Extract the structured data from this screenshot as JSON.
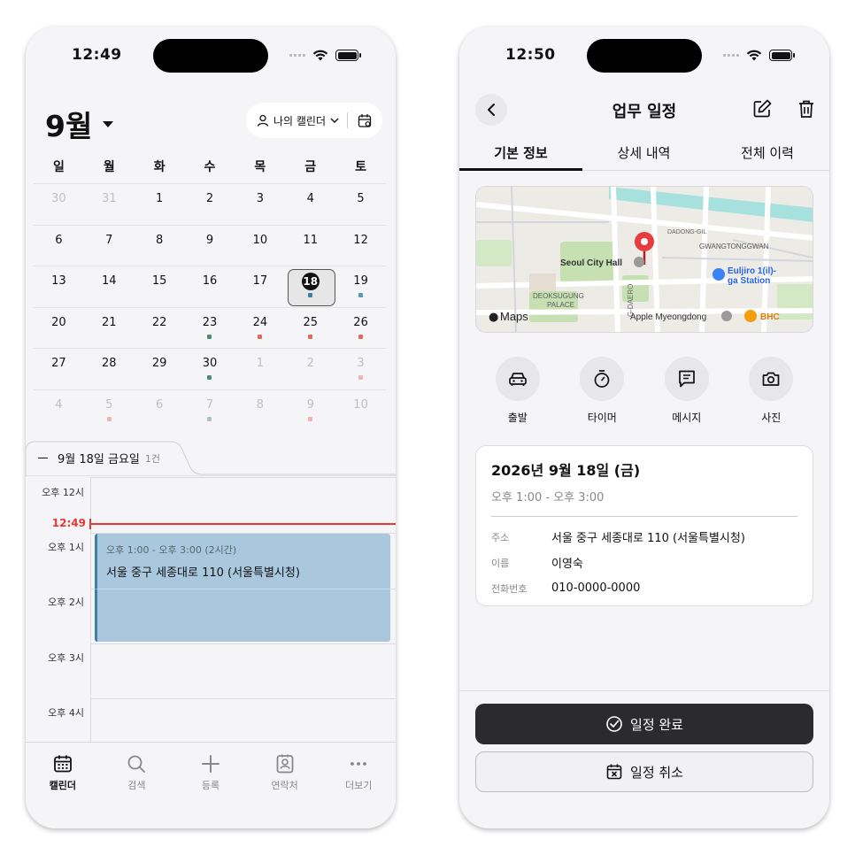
{
  "left": {
    "status": {
      "time": "12:49"
    },
    "header": {
      "month": "9월",
      "calendar_label": "나의 캘린더"
    },
    "weekdays": [
      "일",
      "월",
      "화",
      "수",
      "목",
      "금",
      "토"
    ],
    "weeks": [
      [
        {
          "d": "30",
          "m": true
        },
        {
          "d": "31",
          "m": true
        },
        {
          "d": "1"
        },
        {
          "d": "2"
        },
        {
          "d": "3"
        },
        {
          "d": "4"
        },
        {
          "d": "5"
        }
      ],
      [
        {
          "d": "6"
        },
        {
          "d": "7"
        },
        {
          "d": "8"
        },
        {
          "d": "9"
        },
        {
          "d": "10"
        },
        {
          "d": "11"
        },
        {
          "d": "12"
        }
      ],
      [
        {
          "d": "13"
        },
        {
          "d": "14"
        },
        {
          "d": "15"
        },
        {
          "d": "16"
        },
        {
          "d": "17"
        },
        {
          "d": "18",
          "sel": true,
          "dot": "#3d7fa5"
        },
        {
          "d": "19",
          "dot": "#5a9ab8"
        }
      ],
      [
        {
          "d": "20"
        },
        {
          "d": "21"
        },
        {
          "d": "22"
        },
        {
          "d": "23",
          "dot": "#4f8c6f"
        },
        {
          "d": "24",
          "dot": "#e26a5d"
        },
        {
          "d": "25",
          "dot": "#e26a5d"
        },
        {
          "d": "26",
          "dot": "#e26a5d"
        }
      ],
      [
        {
          "d": "27"
        },
        {
          "d": "28"
        },
        {
          "d": "29"
        },
        {
          "d": "30",
          "dot": "#4f8c6f"
        },
        {
          "d": "1",
          "m": true
        },
        {
          "d": "2",
          "m": true
        },
        {
          "d": "3",
          "m": true,
          "dot": "#e26a5d"
        }
      ],
      [
        {
          "d": "4",
          "m": true
        },
        {
          "d": "5",
          "m": true,
          "dot": "#e26a5d"
        },
        {
          "d": "6",
          "m": true
        },
        {
          "d": "7",
          "m": true,
          "dot": "#4f8c6f"
        },
        {
          "d": "8",
          "m": true
        },
        {
          "d": "9",
          "m": true,
          "dot": "#e26a5d"
        },
        {
          "d": "10",
          "m": true
        }
      ]
    ],
    "day_panel": {
      "date": "9월 18일 금요일",
      "count": "1건"
    },
    "timeline": {
      "hours": [
        "오후 12시",
        "오후 1시",
        "오후 2시",
        "오후 3시",
        "오후 4시"
      ],
      "now": "12:49",
      "event": {
        "time": "오후 1:00 - 오후 3:00 (2시간)",
        "title": "서울 중구 세종대로 110 (서울특별시청)"
      }
    },
    "tabbar": [
      {
        "label": "캘린더",
        "icon": "calendar-icon"
      },
      {
        "label": "검색",
        "icon": "search-icon"
      },
      {
        "label": "등록",
        "icon": "plus-icon"
      },
      {
        "label": "연락처",
        "icon": "contact-icon"
      },
      {
        "label": "더보기",
        "icon": "more-icon"
      }
    ],
    "colors": {
      "now_line": "#e53935",
      "event_bg": "#a9c8dd",
      "event_bar": "#3f7fa8"
    }
  },
  "right": {
    "status": {
      "time": "12:50"
    },
    "nav": {
      "title": "업무 일정"
    },
    "tabs": [
      "기본 정보",
      "상세 내역",
      "전체 이력"
    ],
    "map": {
      "labels": {
        "city_hall": "Seoul City Hall",
        "deoksugung1": "DEOKSUGUNG",
        "deoksugung2": "PALACE",
        "dadong": "DADONG-GIL",
        "gwangtong": "GWANGTONGGWAN",
        "euljiro1": "Euljiro 1(il)-",
        "euljiro2": "ga Station",
        "daero": "G-DAERO",
        "apple": "Apple Myeongdong",
        "bhc": "BHC",
        "brand": "Maps"
      }
    },
    "actions": [
      {
        "label": "출발",
        "icon": "car-icon"
      },
      {
        "label": "타이머",
        "icon": "timer-icon"
      },
      {
        "label": "메시지",
        "icon": "message-icon"
      },
      {
        "label": "사진",
        "icon": "camera-icon"
      }
    ],
    "info": {
      "date": "2026년 9월 18일 (금)",
      "time": "오후 1:00 - 오후 3:00",
      "rows": [
        {
          "key": "주소",
          "value": "서울 중구 세종대로 110 (서울특별시청)"
        },
        {
          "key": "이름",
          "value": "이영숙"
        },
        {
          "key": "전화번호",
          "value": "010-0000-0000"
        }
      ]
    },
    "buttons": {
      "complete": "일정 완료",
      "cancel": "일정 취소"
    }
  }
}
